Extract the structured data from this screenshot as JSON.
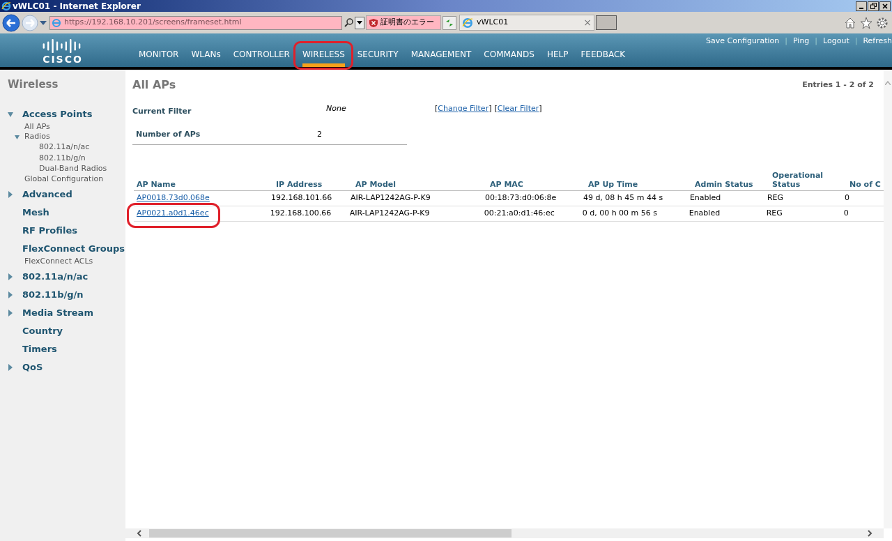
{
  "browser": {
    "window_title": "vWLC01 - Internet Explorer",
    "address": "https://192.168.10.201/screens/frameset.html",
    "cert_error": "証明書のエラー",
    "tab_title": "vWLC01",
    "tab_close": "×"
  },
  "header": {
    "logo": "CISCO",
    "top_links": [
      {
        "kind": "link",
        "text": "Save Configuration"
      },
      {
        "kind": "separator",
        "text": "|"
      },
      {
        "kind": "link",
        "text": "Ping"
      },
      {
        "kind": "separator",
        "text": "|"
      },
      {
        "kind": "link",
        "text": "Logout"
      },
      {
        "kind": "separator",
        "text": "|"
      },
      {
        "kind": "link",
        "text": "Refresh"
      }
    ],
    "nav": [
      {
        "label": "MONITOR",
        "selected": false,
        "highlighted": false
      },
      {
        "label": "WLANs",
        "selected": false,
        "highlighted": false
      },
      {
        "label": "CONTROLLER",
        "selected": false,
        "highlighted": false
      },
      {
        "label": "WIRELESS",
        "selected": true,
        "highlighted": true
      },
      {
        "label": "SECURITY",
        "selected": false,
        "highlighted": false
      },
      {
        "label": "MANAGEMENT",
        "selected": false,
        "highlighted": false
      },
      {
        "label": "COMMANDS",
        "selected": false,
        "highlighted": false
      },
      {
        "label": "HELP",
        "selected": false,
        "highlighted": false
      },
      {
        "label": "FEEDBACK",
        "selected": false,
        "highlighted": false
      }
    ]
  },
  "sidebar": {
    "title": "Wireless",
    "items": [
      {
        "label": "Access Points",
        "expanded": true,
        "children": [
          {
            "label": "All APs"
          },
          {
            "label": "Radios",
            "expanded": true,
            "children": [
              {
                "label": "802.11a/n/ac"
              },
              {
                "label": "802.11b/g/n"
              },
              {
                "label": "Dual-Band Radios"
              }
            ]
          },
          {
            "label": "Global Configuration"
          }
        ]
      },
      {
        "label": "Advanced",
        "expanded": false
      },
      {
        "label": "Mesh"
      },
      {
        "label": "RF Profiles"
      },
      {
        "label": "FlexConnect Groups",
        "children": [
          {
            "label": "FlexConnect ACLs"
          }
        ]
      },
      {
        "label": "802.11a/n/ac",
        "expanded": false
      },
      {
        "label": "802.11b/g/n",
        "expanded": false
      },
      {
        "label": "Media Stream",
        "expanded": false
      },
      {
        "label": "Country"
      },
      {
        "label": "Timers"
      },
      {
        "label": "QoS",
        "expanded": false
      }
    ]
  },
  "page": {
    "title": "All APs",
    "entries": "Entries 1 - 2 of 2",
    "current_filter_label": "Current Filter",
    "current_filter_value": "None",
    "filter_links": [
      {
        "kind": "bracket",
        "text": "["
      },
      {
        "kind": "link",
        "text": "Change Filter"
      },
      {
        "kind": "bracket",
        "text": "]"
      },
      {
        "kind": "bracket",
        "text": "["
      },
      {
        "kind": "link",
        "text": "Clear Filter"
      },
      {
        "kind": "bracket",
        "text": "]"
      }
    ],
    "count_label": "Number of APs",
    "count_value": "2"
  },
  "table": {
    "columns": [
      "AP Name",
      "IP Address",
      "AP Model",
      "AP MAC",
      "AP Up Time",
      "Admin Status",
      "Operational Status",
      "No of C"
    ],
    "rows": [
      {
        "highlighted": false,
        "cells": [
          "AP0018.73d0.068e",
          "192.168.101.66",
          "AIR-LAP1242AG-P-K9",
          "00:18:73:d0:06:8e",
          "49 d, 08 h 45 m 44 s",
          "Enabled",
          "REG",
          "0"
        ]
      },
      {
        "highlighted": true,
        "cells": [
          "AP0021.a0d1.46ec",
          "192.168.100.66",
          "AIR-LAP1242AG-P-K9",
          "00:21:a0:d1:46:ec",
          "0 d, 00 h 00 m 56 s",
          "Enabled",
          "REG",
          "0"
        ]
      }
    ]
  }
}
